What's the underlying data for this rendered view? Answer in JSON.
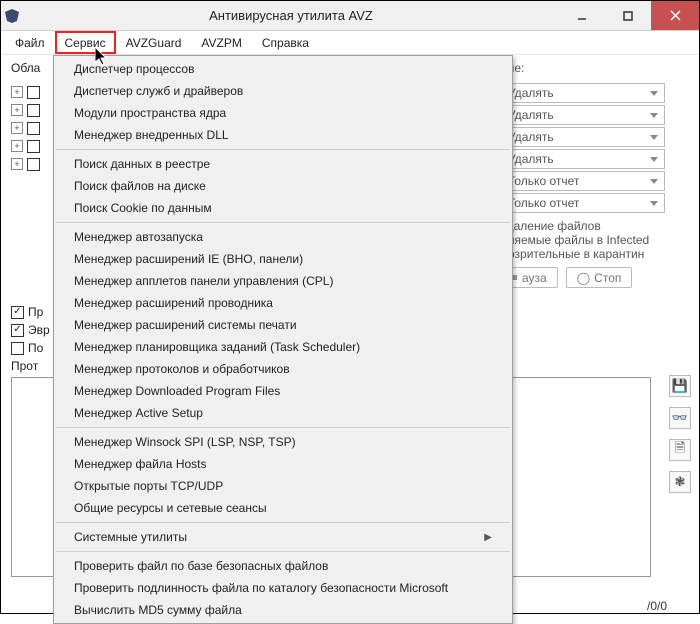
{
  "window": {
    "title": "Антивирусная утилита AVZ"
  },
  "menubar": {
    "file": "Файл",
    "service": "Сервис",
    "avzguard": "AVZGuard",
    "avzpm": "AVZPM",
    "help": "Справка"
  },
  "tabs": {
    "area": "Обла"
  },
  "tree_fragment_label": "",
  "left": {
    "checks": {
      "pr": "Пр",
      "evr": "Эвр",
      "po": "По"
    },
    "protocol_label": "Прот"
  },
  "right": {
    "heading_fragment": "ние:",
    "drop1": "Удалять",
    "drop2": "Удалять",
    "drop3": "Удалять",
    "drop4": "Удалять",
    "drop5": "Только отчет",
    "drop6": "Только отчет",
    "note1": "удаление файлов",
    "note2": "яляемые файлы в  Infected",
    "note3": "дозрительные в  карантин",
    "btn_pause": "ауза",
    "btn_stop": "Стоп"
  },
  "status": {
    "progress": "/0/0"
  },
  "side_icons": {
    "save": "save-icon",
    "glasses": "glasses-icon",
    "doc": "document-icon",
    "bug": "bug-icon"
  },
  "dropdown": {
    "items": [
      "Диспетчер процессов",
      "Диспетчер служб и драйверов",
      "Модули пространства ядра",
      "Менеджер внедренных DLL",
      "—",
      "Поиск данных  в реестре",
      "Поиск файлов на диске",
      "Поиск Cookie по данным",
      "—",
      "Менеджер автозапуска",
      "Менеджер расширений IE (BHO, панели)",
      "Менеджер апплетов панели управления (CPL)",
      "Менеджер расширений проводника",
      "Менеджер расширений системы печати",
      "Менеджер планировщика заданий (Task Scheduler)",
      "Менеджер протоколов и обработчиков",
      "Менеджер Downloaded Program Files",
      "Менеджер Active Setup",
      "—",
      "Менеджер Winsock SPI (LSP, NSP, TSP)",
      "Менеджер файла Hosts",
      "Открытые порты TCP/UDP",
      "Общие ресурсы и сетевые сеансы",
      "—",
      "Системные утилиты",
      "—",
      "Проверить файл по базе безопасных файлов",
      "Проверить подлинность файла по каталогу безопасности Microsoft",
      "Вычислить MD5 сумму файла"
    ],
    "submenu_index": 24
  }
}
